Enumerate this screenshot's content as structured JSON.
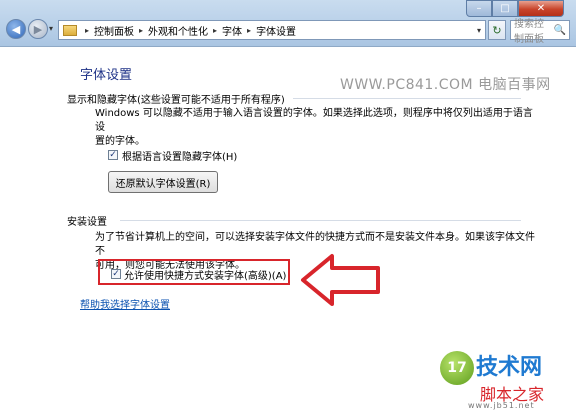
{
  "window": {
    "minimize": "–",
    "maximize": "□",
    "close": "✕"
  },
  "nav": {
    "back": "◀",
    "forward": "▶",
    "dropdown": "▾",
    "refresh": "↻"
  },
  "address": {
    "crumbs": [
      "控制面板",
      "外观和个性化",
      "字体",
      "字体设置"
    ],
    "separator": "▸"
  },
  "search": {
    "placeholder": "搜索控制面板",
    "icon": "🔍"
  },
  "page": {
    "title": "字体设置",
    "watermark": "WWW.PC841.COM 电脑百事网"
  },
  "section_display": {
    "heading": "显示和隐藏字体(这些设置可能不适用于所有程序)",
    "desc_line1": "Windows 可以隐藏不适用于输入语言设置的字体。如果选择此选项，则程序中将仅列出适用于语言设",
    "desc_line2": "置的字体。",
    "checkbox_label": "根据语言设置隐藏字体(H)",
    "checkbox_checked": true,
    "restore_button": "还原默认字体设置(R)"
  },
  "section_install": {
    "heading": "安装设置",
    "desc_line1": "为了节省计算机上的空间，可以选择安装字体文件的快捷方式而不是安装文件本身。如果该字体文件不",
    "desc_line2": "可用，则您可能无法使用该字体。",
    "checkbox_label": "允许使用快捷方式安装字体(高级)(A)",
    "checkbox_checked": true
  },
  "help_link": "帮助我选择字体设置",
  "logo": {
    "badge": "17",
    "big": "技术网",
    "small1": "脚本之家",
    "small2": "www.jb51.net"
  },
  "colors": {
    "highlight": "#d8252b",
    "link": "#0b52b0",
    "title": "#1e3287"
  }
}
